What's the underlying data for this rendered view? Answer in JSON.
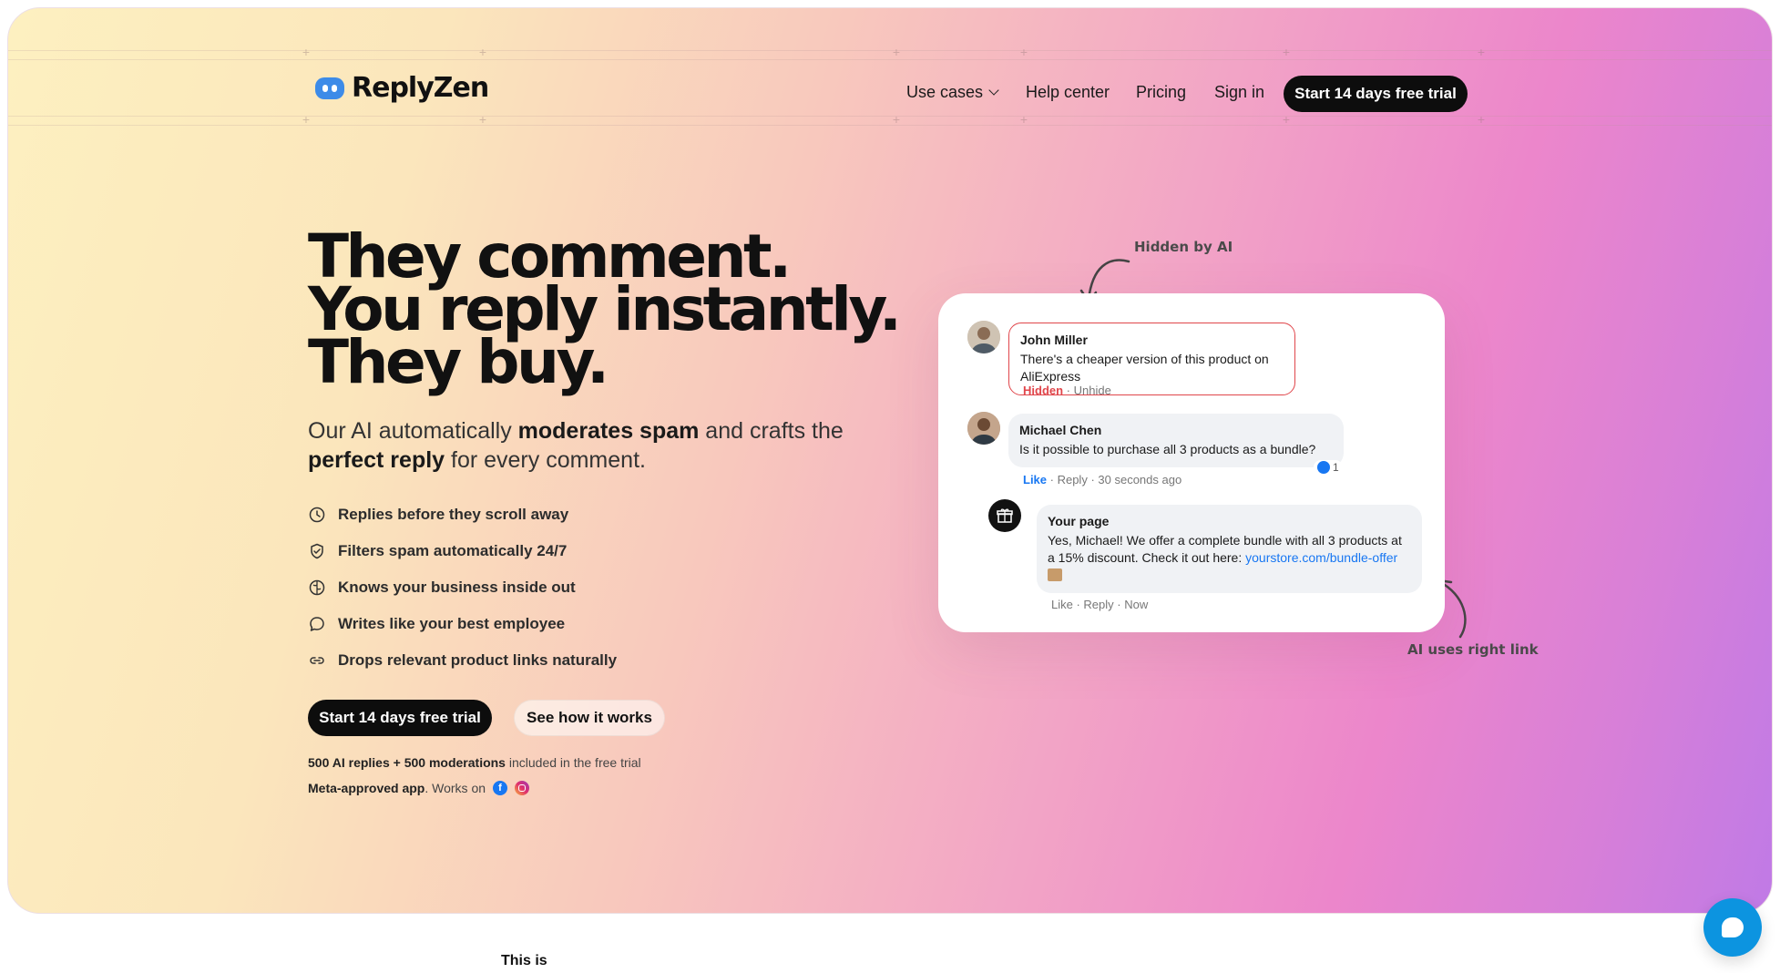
{
  "brand": {
    "name": "ReplyZen"
  },
  "nav": {
    "use_cases": "Use cases",
    "help_center": "Help center",
    "pricing": "Pricing",
    "sign_in": "Sign in",
    "cta": "Start 14 days free trial"
  },
  "hero": {
    "headline": [
      "They comment.",
      "You reply instantly.",
      "They buy."
    ],
    "sub_1": "Our AI automatically ",
    "sub_bold_1": "moderates spam",
    "sub_2": " and crafts the ",
    "sub_bold_2": "perfect reply",
    "sub_3": " for every comment.",
    "features": [
      {
        "icon": "clock-icon",
        "label": "Replies before they scroll away"
      },
      {
        "icon": "shield-check-icon",
        "label": "Filters spam automatically 24/7"
      },
      {
        "icon": "brain-icon",
        "label": "Knows your business inside out"
      },
      {
        "icon": "chat-bubble-icon",
        "label": "Writes like your best employee"
      },
      {
        "icon": "link-icon",
        "label": "Drops relevant product links naturally"
      }
    ],
    "cta_primary": "Start 14 days free trial",
    "cta_secondary": "See how it works",
    "trial_bold": "500 AI replies + 500 moderations",
    "trial_rest": " included in the free trial",
    "meta_bold": "Meta-approved app",
    "meta_rest": ". Works on"
  },
  "demo": {
    "annotation_hidden": "Hidden by AI",
    "annotation_link": "AI uses right link",
    "comment1": {
      "name": "John Miller",
      "text": "There's a cheaper version of this product on AliExpress",
      "status": "Hidden",
      "action": "Unhide"
    },
    "comment2": {
      "name": "Michael Chen",
      "text": "Is it possible to purchase all 3 products as a bundle?",
      "like": "Like",
      "reply": "Reply",
      "time": "30 seconds ago",
      "reactions": "1"
    },
    "reply": {
      "name": "Your page",
      "text": "Yes, Michael! We offer a complete bundle with all 3 products at a 15% discount. Check it out here: ",
      "link": "yourstore.com/bundle-offer",
      "like": "Like",
      "reply": "Reply",
      "time": "Now"
    }
  },
  "below": {
    "text": "This is"
  },
  "colors": {
    "cta": "#0d0d0d",
    "hidden": "#e0464b",
    "fb_blue": "#1877f2",
    "chat": "#0c94e0"
  }
}
